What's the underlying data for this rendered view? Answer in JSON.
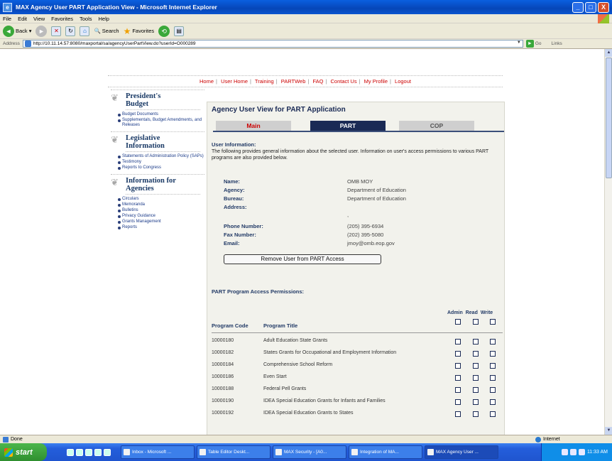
{
  "window": {
    "title": "MAX Agency User PART Application View - Microsoft Internet Explorer",
    "min": "_",
    "max": "□",
    "close": "X"
  },
  "menu": [
    "File",
    "Edit",
    "View",
    "Favorites",
    "Tools",
    "Help"
  ],
  "toolbar": {
    "back": "Back",
    "search": "Search",
    "favorites": "Favorites"
  },
  "address": {
    "label": "Address",
    "url": "http://10.11.14.57:8080/maxportal/sa/agencyUserPartView.do?userId=O000289",
    "go": "Go",
    "links": "Links"
  },
  "topnav": [
    "Home",
    "User Home",
    "Training",
    "PARTWeb",
    "FAQ",
    "Contact Us",
    "My Profile",
    "Logout"
  ],
  "sidebar": [
    {
      "title_lines": [
        "President's",
        "Budget"
      ],
      "items": [
        "Budget Documents",
        "Supplementals, Budget Amendments, and Releases"
      ]
    },
    {
      "title_lines": [
        "Legislative",
        "Information"
      ],
      "items": [
        "Statements of Administration Policy (SAPs)",
        "Testimony",
        "Reports to Congress"
      ]
    },
    {
      "title_lines": [
        "Information for",
        "Agencies"
      ],
      "items": [
        "Circulars",
        "Memoranda",
        "Bulletins",
        "Privacy Guidance",
        "Grants Management",
        "Reports"
      ]
    }
  ],
  "main": {
    "title": "Agency User View for PART Application",
    "tabs": [
      "Main",
      "PART",
      "COP"
    ],
    "info_heading": "User Information:",
    "info_desc": "The following provides general information about the selected user. Information on user's access permissions to various PART programs are also provided below.",
    "fields": {
      "name_label": "Name:",
      "name": "OMB MOY",
      "agency_label": "Agency:",
      "agency": "Department of Education",
      "bureau_label": "Bureau:",
      "bureau": "Department of Education",
      "address_label": "Address:",
      "address": ",",
      "phone_label": "Phone Number:",
      "phone": "(205) 395-6934",
      "fax_label": "Fax Number:",
      "fax": "(202) 395-5080",
      "email_label": "Email:",
      "email": "jmoy@omb.eop.gov"
    },
    "remove_button": "Remove User from PART Access",
    "perm_heading": "PART Program Access Permissions:",
    "perm_cols": [
      "Admin",
      "Read",
      "Write"
    ],
    "col_code": "Program Code",
    "col_title": "Program Title",
    "programs": [
      {
        "code": "10000180",
        "title": "Adult Education State Grants"
      },
      {
        "code": "10000182",
        "title": "States Grants for Occupational and Employment Information"
      },
      {
        "code": "10000184",
        "title": "Comprehensive School Reform"
      },
      {
        "code": "10000186",
        "title": "Even Start"
      },
      {
        "code": "10000188",
        "title": "Federal Pell Grants"
      },
      {
        "code": "10000190",
        "title": "IDEA Special Education Grants for Infants and Families"
      },
      {
        "code": "10000192",
        "title": "IDEA Special Education Grants to States"
      }
    ]
  },
  "status": {
    "text": "Done",
    "zone": "Internet"
  },
  "taskbar": {
    "start": "start",
    "tasks": [
      "Inbox - Microsoft ...",
      "Table Editor Deskt...",
      "MAX Security - [A0...",
      "Integration of MA...",
      "MAX Agency User ..."
    ],
    "clock": "11:33 AM"
  }
}
